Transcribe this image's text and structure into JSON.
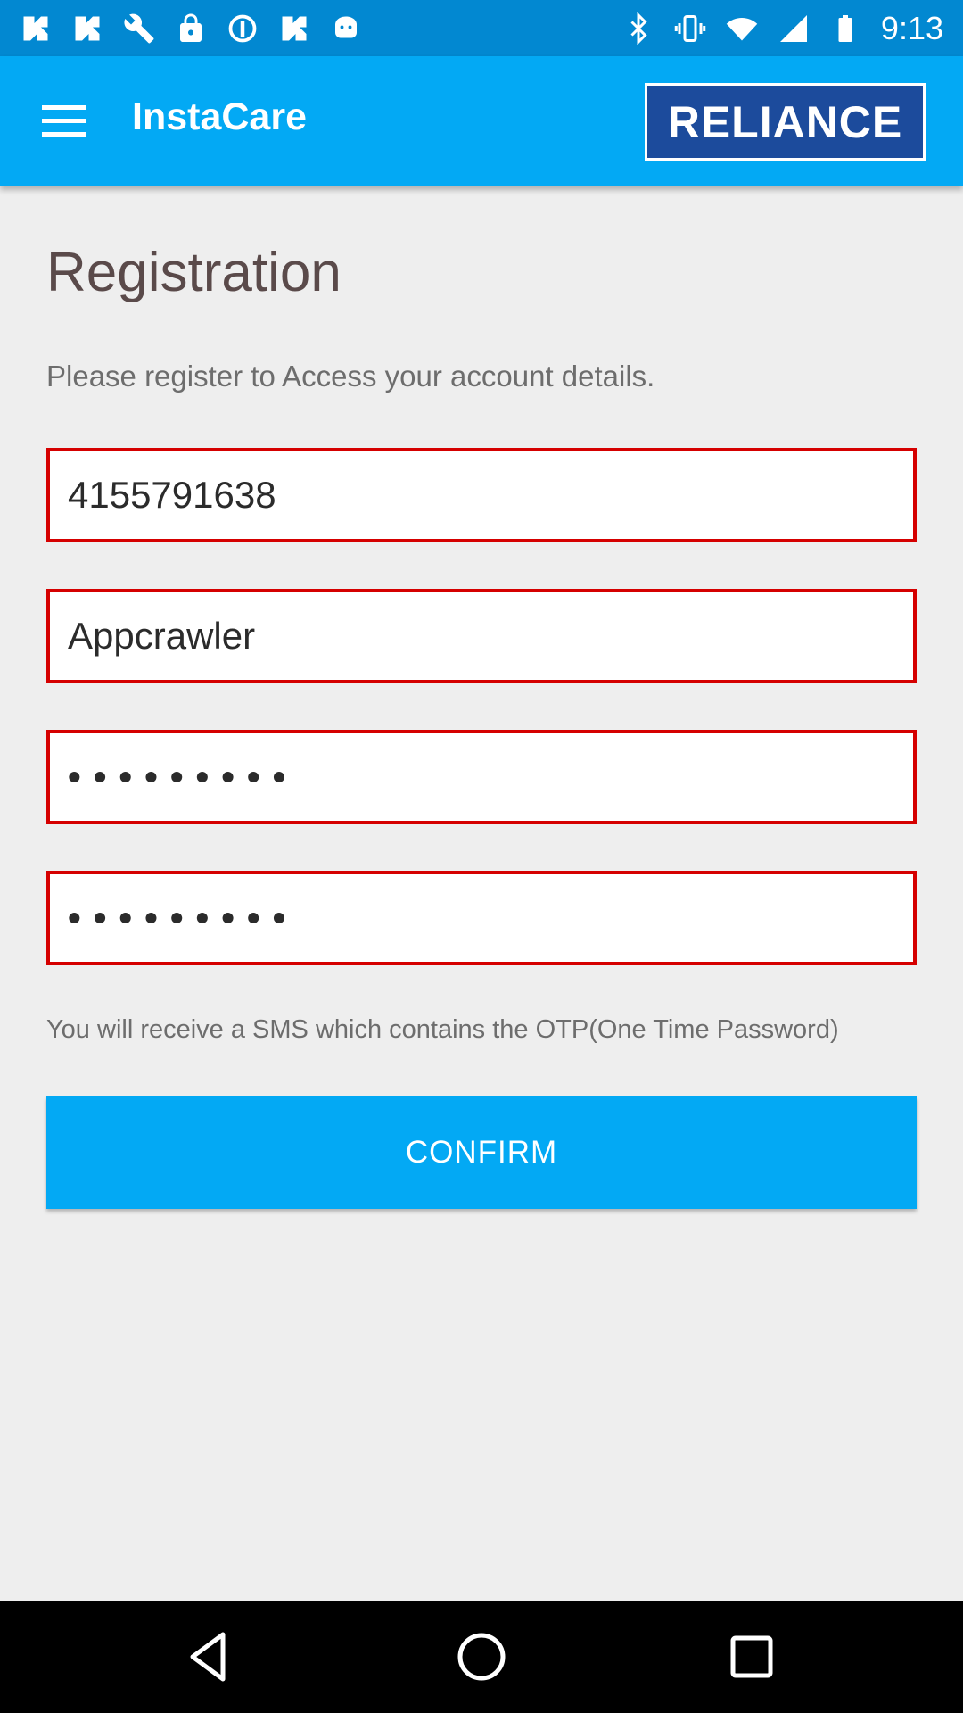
{
  "status_bar": {
    "time": "9:13",
    "left_icons": [
      "notification-icon",
      "notification-icon",
      "wrench-icon",
      "lock-icon",
      "settings-circle-icon",
      "notification-icon",
      "android-icon"
    ],
    "right_icons": [
      "bluetooth-icon",
      "vibrate-icon",
      "wifi-icon",
      "signal-icon",
      "battery-icon"
    ]
  },
  "app_bar": {
    "title": "InstaCare",
    "brand": "RELIANCE"
  },
  "registration": {
    "title": "Registration",
    "subtitle": "Please register to Access your account details.",
    "fields": [
      {
        "value": "4155791638"
      },
      {
        "value": "Appcrawler"
      },
      {
        "value": "•••••••••"
      },
      {
        "value": "•••••••••"
      }
    ],
    "sms_note": "You will receive a SMS which contains the OTP(One Time Password)",
    "confirm_label": "CONFIRM"
  },
  "colors": {
    "primary": "#03a9f4",
    "primary_dark": "#0288d1",
    "field_border": "#d50000",
    "brand_bg": "#1c4b9c"
  }
}
